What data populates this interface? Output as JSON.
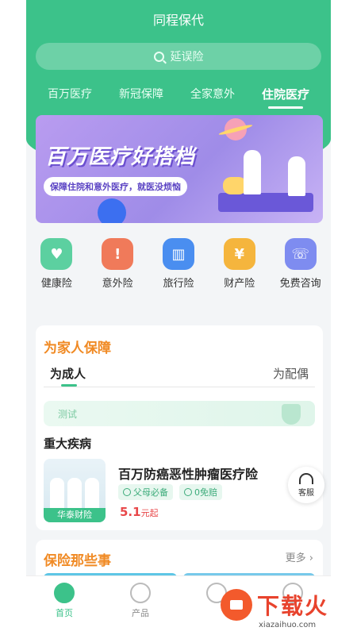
{
  "header": {
    "title": "同程保代",
    "search_placeholder": "延误险",
    "tabs": [
      {
        "label": "百万医疗"
      },
      {
        "label": "新冠保障"
      },
      {
        "label": "全家意外"
      },
      {
        "label": "住院医疗",
        "active": true
      }
    ],
    "accent_color": "#3cc28a"
  },
  "banner": {
    "headline": "百万医疗好搭档",
    "subtext": "保障住院和意外医疗，就医没烦恼"
  },
  "categories": [
    {
      "label": "健康险",
      "icon": "heart-pulse-icon",
      "color": "#5cd0a0"
    },
    {
      "label": "意外险",
      "icon": "warning-icon",
      "color": "#f07a5a"
    },
    {
      "label": "旅行险",
      "icon": "suitcase-icon",
      "color": "#4a8ef0"
    },
    {
      "label": "财产险",
      "icon": "money-bag-icon",
      "color": "#f5b53d"
    },
    {
      "label": "免费咨询",
      "icon": "phone-icon",
      "color": "#7e8cf0"
    }
  ],
  "family": {
    "title": "为家人保障",
    "tab_adult": "为成人",
    "tab_spouse": "为配偶",
    "test_label": "测试",
    "section": "重大疾病",
    "product": {
      "image_tag": "华泰财险",
      "name": "百万防癌恶性肿瘤医疗险",
      "badges": [
        "父母必备",
        "0免赔"
      ],
      "price": "5.1",
      "price_unit": "元起"
    }
  },
  "service": {
    "label": "客服"
  },
  "insurance_things": {
    "title": "保险那些事",
    "more": "更多 ›"
  },
  "nav": [
    {
      "label": "首页",
      "active": true
    },
    {
      "label": "产品"
    },
    {
      "label": ""
    },
    {
      "label": ""
    }
  ],
  "watermark": {
    "title": "下载火",
    "url": "xiazaihuo.com"
  }
}
